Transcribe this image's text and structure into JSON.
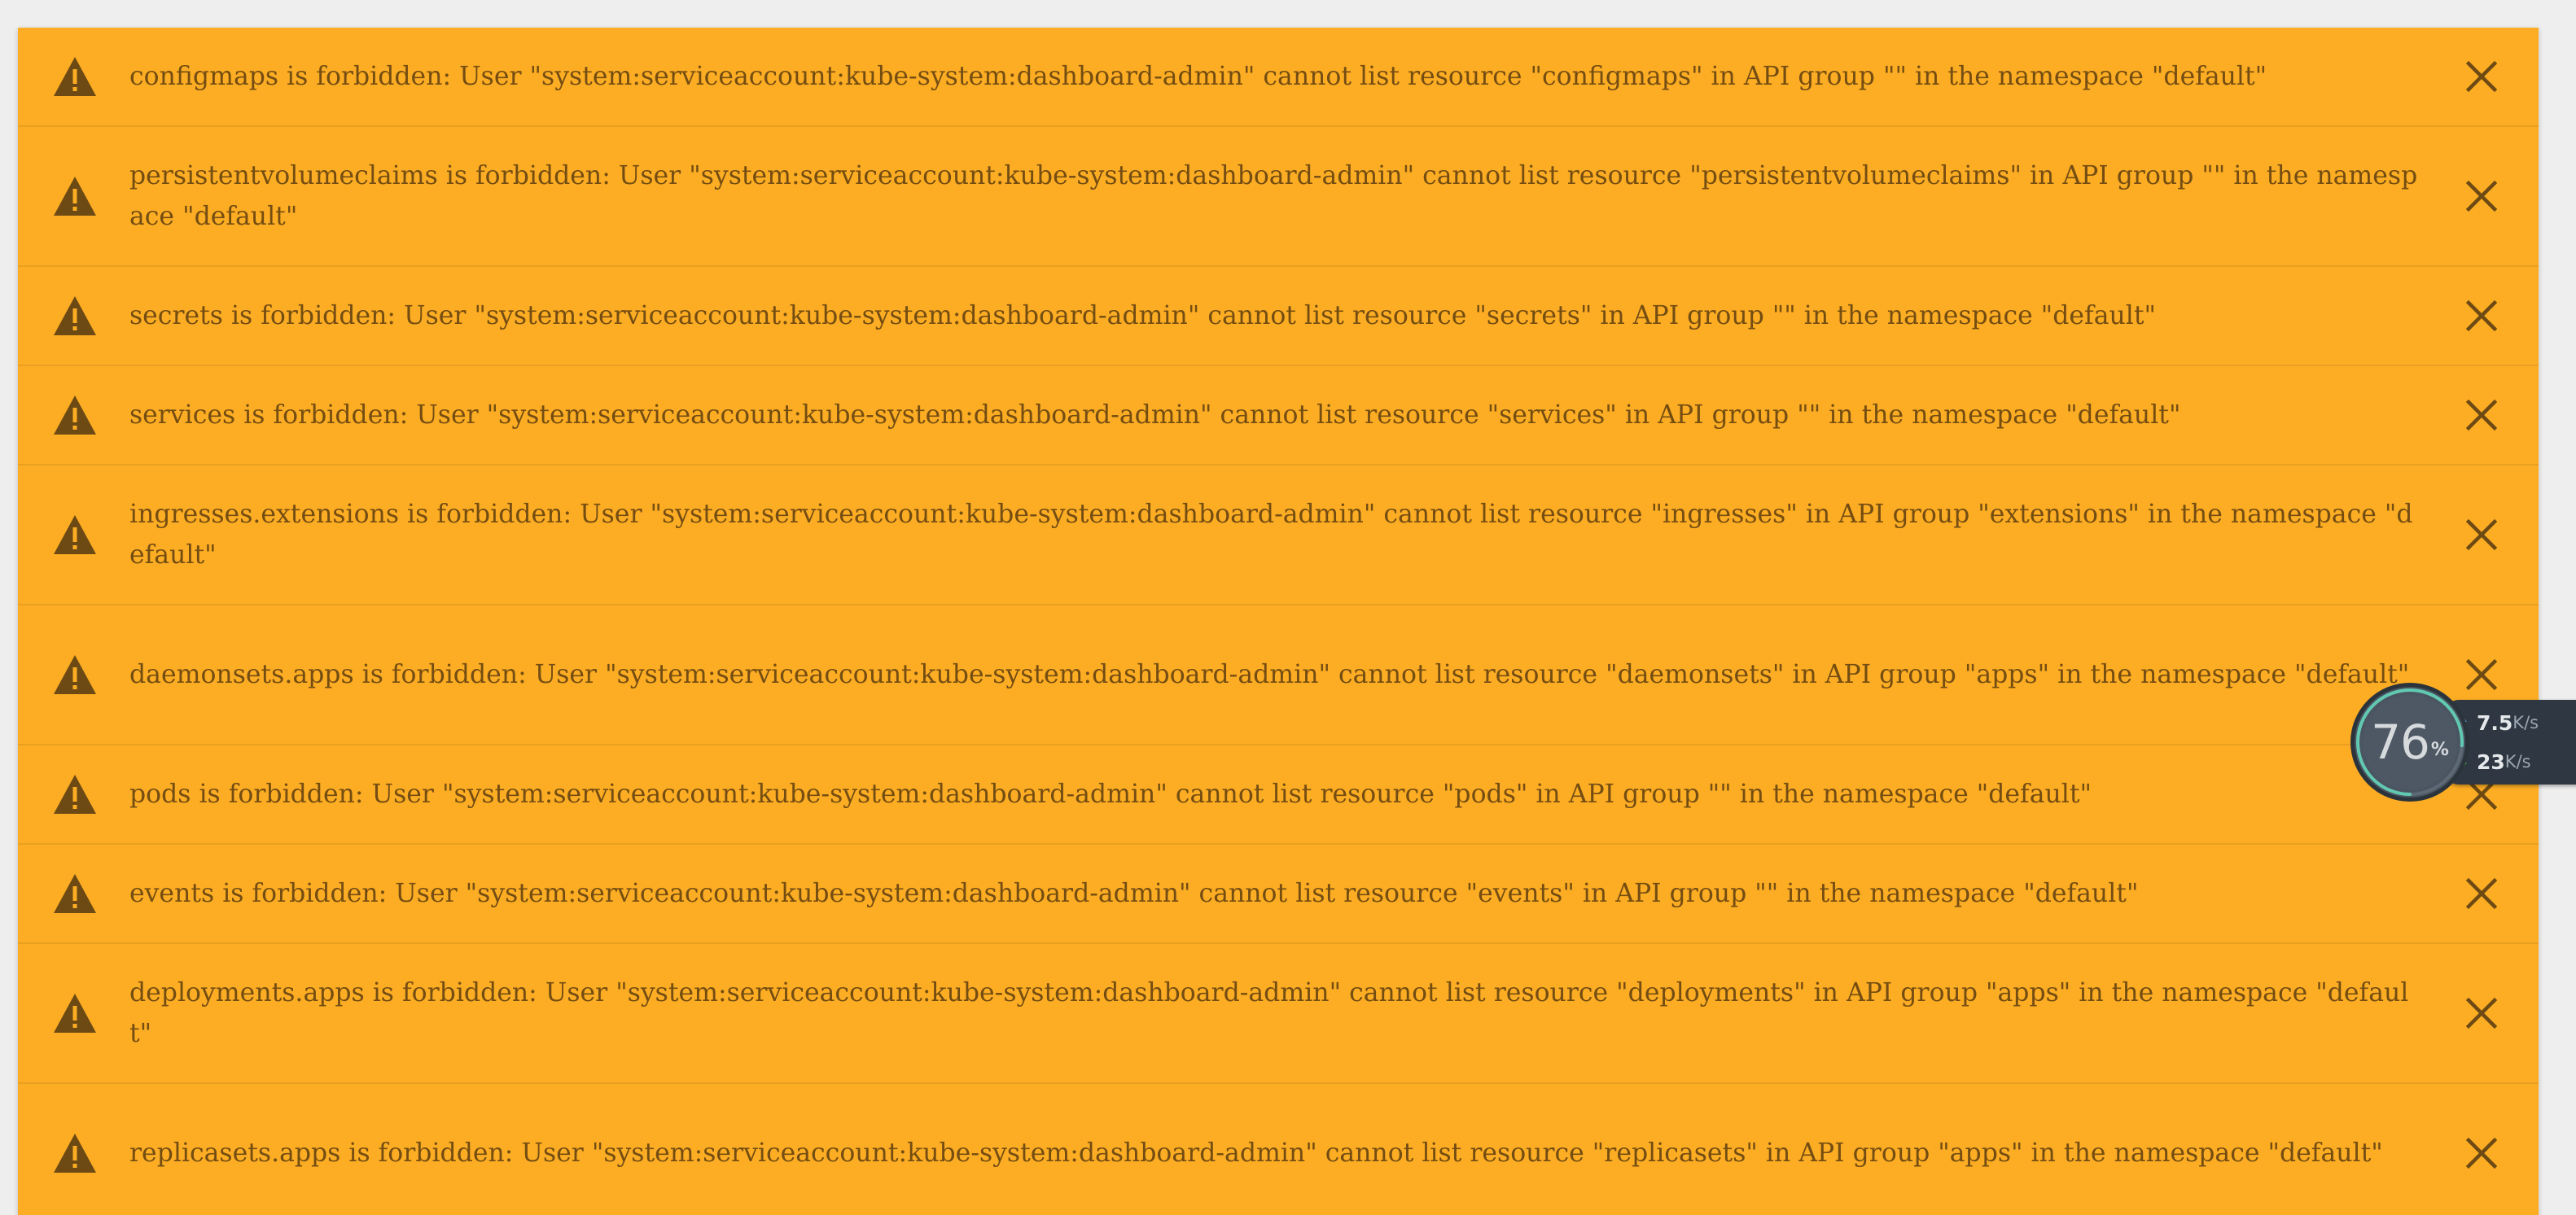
{
  "colors": {
    "alert_background": "#fdad23",
    "alert_text": "#744d12",
    "icon": "#6d4a14",
    "page_background": "#eeeeee"
  },
  "alerts": [
    {
      "icon": "warning-icon",
      "text": "configmaps is forbidden: User \"system:serviceaccount:kube-system:dashboard-admin\" cannot list resource \"configmaps\" in API group \"\" in the namespace \"default\"",
      "lines": 1
    },
    {
      "icon": "warning-icon",
      "text": "persistentvolumeclaims is forbidden: User \"system:serviceaccount:kube-system:dashboard-admin\" cannot list resource \"persistentvolumeclaims\" in API group \"\" in the namespace \"default\"",
      "lines": 2
    },
    {
      "icon": "warning-icon",
      "text": "secrets is forbidden: User \"system:serviceaccount:kube-system:dashboard-admin\" cannot list resource \"secrets\" in API group \"\" in the namespace \"default\"",
      "lines": 1
    },
    {
      "icon": "warning-icon",
      "text": "services is forbidden: User \"system:serviceaccount:kube-system:dashboard-admin\" cannot list resource \"services\" in API group \"\" in the namespace \"default\"",
      "lines": 1
    },
    {
      "icon": "warning-icon",
      "text": "ingresses.extensions is forbidden: User \"system:serviceaccount:kube-system:dashboard-admin\" cannot list resource \"ingresses\" in API group \"extensions\" in the namespace \"default\"",
      "lines": 2
    },
    {
      "icon": "warning-icon",
      "text": "daemonsets.apps is forbidden: User \"system:serviceaccount:kube-system:dashboard-admin\" cannot list resource \"daemonsets\" in API group \"apps\" in the namespace \"default\"",
      "lines": 2
    },
    {
      "icon": "warning-icon",
      "text": "pods is forbidden: User \"system:serviceaccount:kube-system:dashboard-admin\" cannot list resource \"pods\" in API group \"\" in the namespace \"default\"",
      "lines": 1
    },
    {
      "icon": "warning-icon",
      "text": "events is forbidden: User \"system:serviceaccount:kube-system:dashboard-admin\" cannot list resource \"events\" in API group \"\" in the namespace \"default\"",
      "lines": 1
    },
    {
      "icon": "warning-icon",
      "text": "deployments.apps is forbidden: User \"system:serviceaccount:kube-system:dashboard-admin\" cannot list resource \"deployments\" in API group \"apps\" in the namespace \"default\"",
      "lines": 2
    },
    {
      "icon": "warning-icon",
      "text": "replicasets.apps is forbidden: User \"system:serviceaccount:kube-system:dashboard-admin\" cannot list resource \"replicasets\" in API group \"apps\" in the namespace \"default\"",
      "lines": 2
    }
  ],
  "net_widget": {
    "percent": "76",
    "percent_unit": "%",
    "percent_fraction": 0.76,
    "upload_value": "7.5",
    "upload_unit": "K/s",
    "download_value": "23",
    "download_unit": "K/s",
    "upload_icon": "arrow-up-icon",
    "download_icon": "arrow-down-icon",
    "upload_color": "#4aa3df",
    "download_color": "#3fae49"
  }
}
